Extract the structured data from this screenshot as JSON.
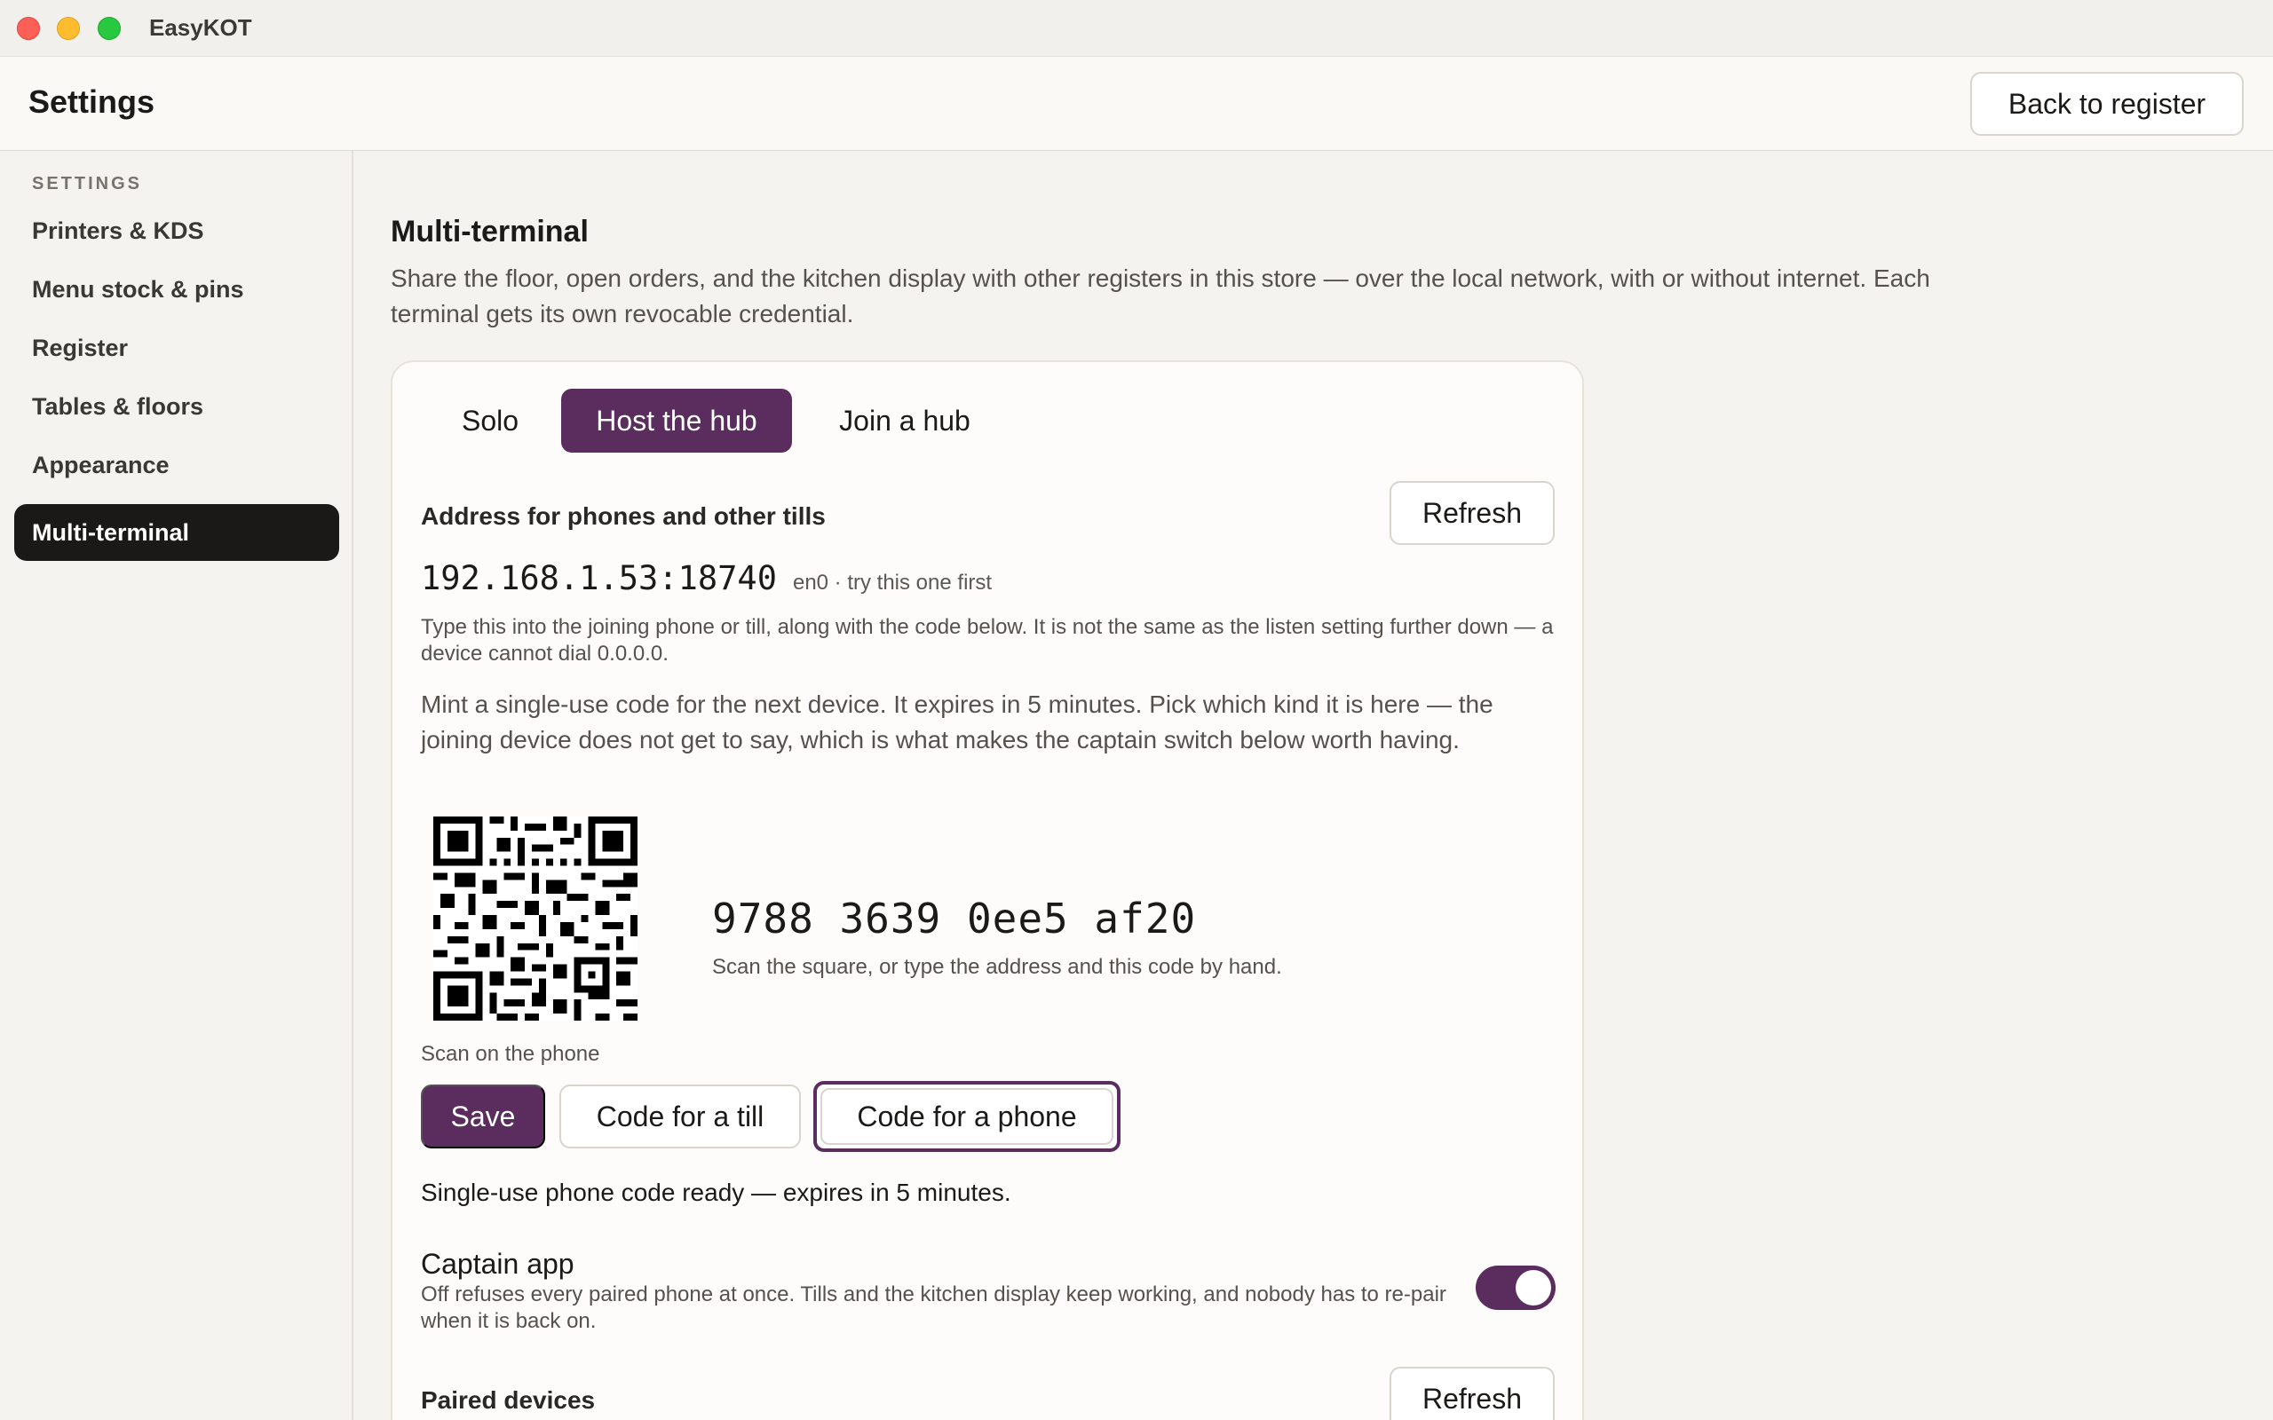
{
  "window": {
    "title": "EasyKOT"
  },
  "header": {
    "title": "Settings",
    "back_label": "Back to register"
  },
  "sidebar": {
    "heading": "SETTINGS",
    "items": [
      {
        "label": "Printers & KDS"
      },
      {
        "label": "Menu stock & pins"
      },
      {
        "label": "Register"
      },
      {
        "label": "Tables & floors"
      },
      {
        "label": "Appearance"
      },
      {
        "label": "Multi-terminal",
        "active": true
      }
    ]
  },
  "main": {
    "title": "Multi-terminal",
    "description": "Share the floor, open orders, and the kitchen display with other registers in this store — over the local network, with or without internet. Each terminal gets its own revocable credential.",
    "tabs": [
      {
        "label": "Solo"
      },
      {
        "label": "Host the hub",
        "selected": true
      },
      {
        "label": "Join a hub"
      }
    ],
    "address": {
      "label": "Address for phones and other tills",
      "refresh_label": "Refresh",
      "value": "192.168.1.53:18740",
      "hint": "en0 · try this one first",
      "note": "Type this into the joining phone or till, along with the code below. It is not the same as the listen setting further down — a device cannot dial 0.0.0.0."
    },
    "mint_note": "Mint a single-use code for the next device. It expires in 5 minutes. Pick which kind it is here — the joining device does not get to say, which is what makes the captain switch below worth having.",
    "code": {
      "value": "9788 3639 0ee5 af20",
      "hint": "Scan the square, or type the address and this code by hand.",
      "scan_label": "Scan on the phone"
    },
    "actions": {
      "save_label": "Save",
      "till_label": "Code for a till",
      "phone_label": "Code for a phone"
    },
    "ready_note": "Single-use phone code ready — expires in 5 minutes.",
    "captain": {
      "title": "Captain app",
      "description": "Off refuses every paired phone at once. Tills and the kitchen display keep working, and nobody has to re-pair when it is back on.",
      "enabled": true
    },
    "paired": {
      "title": "Paired devices",
      "refresh_label": "Refresh"
    }
  },
  "colors": {
    "accent": "#5a2d5e",
    "active_nav": "#1a1917"
  }
}
